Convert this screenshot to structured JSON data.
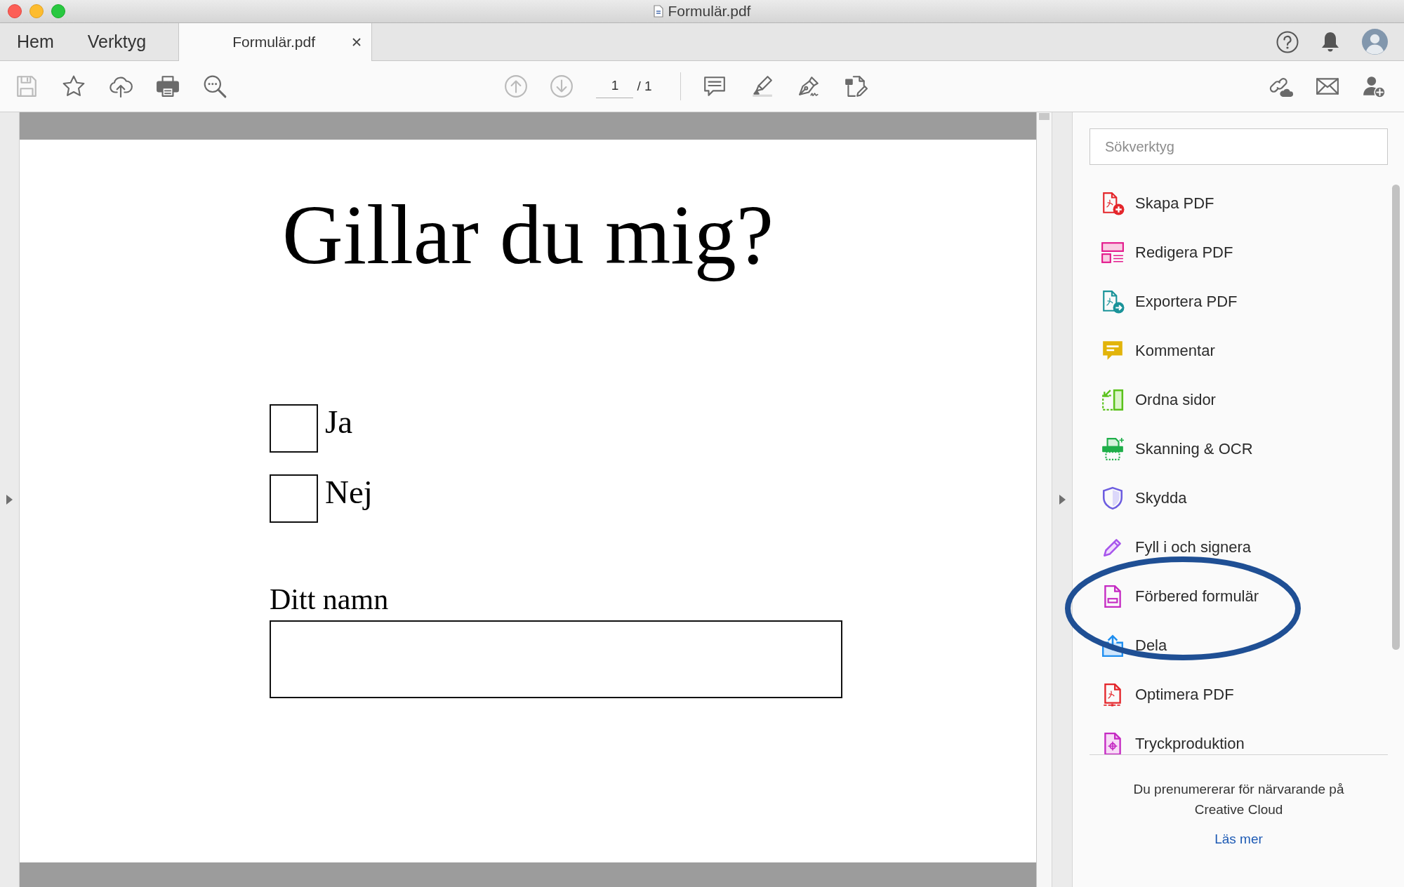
{
  "window": {
    "title": "Formulär.pdf"
  },
  "tabs": [
    {
      "kind": "nav",
      "label": "Hem",
      "selected": false
    },
    {
      "kind": "nav",
      "label": "Verktyg",
      "selected": false
    },
    {
      "kind": "document",
      "label": "Formulär.pdf",
      "selected": true
    }
  ],
  "toolbar": {
    "file_tools": [
      {
        "disabled": true
      },
      {
        "disabled": false
      },
      {
        "disabled": false
      },
      {
        "disabled": false
      },
      {
        "disabled": false
      }
    ],
    "page_navigation": {
      "previous": {
        "disabled": true
      },
      "next": {
        "disabled": true
      },
      "page": "1",
      "total": "/ 1"
    },
    "edit_tools": [
      {
        "disabled": false
      },
      {
        "disabled": false
      },
      {
        "disabled": false
      },
      {
        "disabled": false
      }
    ],
    "share_tools": [
      {
        "disabled": false
      },
      {
        "disabled": false
      },
      {
        "disabled": false
      }
    ]
  },
  "document": {
    "heading": "Gillar du mig?",
    "options": [
      {
        "label": "Ja",
        "checked": false
      },
      {
        "label": "Nej",
        "checked": false
      }
    ],
    "name_field": {
      "label": "Ditt namn"
    }
  },
  "sidebar": {
    "search": {
      "placeholder": "Sökverktyg"
    },
    "items": [
      {
        "label": "Skapa PDF",
        "circled": false
      },
      {
        "label": "Redigera PDF",
        "circled": false
      },
      {
        "label": "Exportera PDF",
        "circled": false
      },
      {
        "label": "Kommentar",
        "circled": false
      },
      {
        "label": "Ordna sidor",
        "circled": false
      },
      {
        "label": "Skanning & OCR",
        "circled": false
      },
      {
        "label": "Skydda",
        "circled": false
      },
      {
        "label": "Fyll i och signera",
        "circled": false
      },
      {
        "label": "Förbered formulär",
        "circled": true
      },
      {
        "label": "Dela",
        "circled": false
      },
      {
        "label": "Optimera PDF",
        "circled": false
      },
      {
        "label": "Tryckproduktion",
        "circled": false
      }
    ],
    "footer": {
      "text": "Du prenumererar för närvarande på Creative Cloud",
      "link": "Läs mer"
    }
  }
}
